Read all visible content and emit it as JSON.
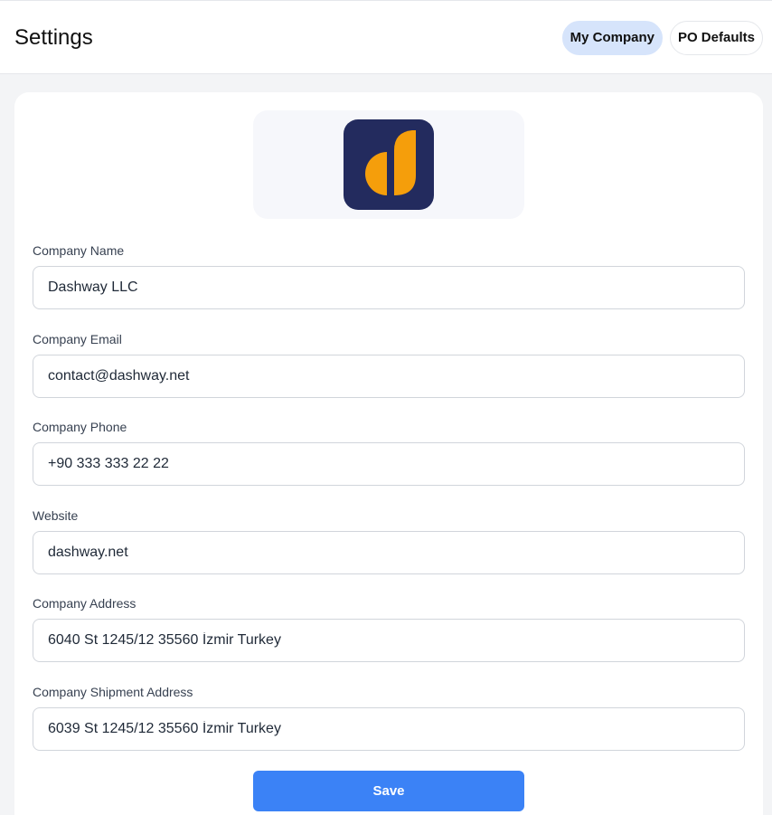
{
  "header": {
    "title": "Settings",
    "tabs": [
      {
        "label": "My Company",
        "active": true
      },
      {
        "label": "PO Defaults",
        "active": false
      }
    ]
  },
  "logo": {
    "icon": "dashway-logo-icon",
    "bg_color": "#232b5e",
    "accent_color": "#f59e0b"
  },
  "form": {
    "company_name": {
      "label": "Company Name",
      "value": "Dashway LLC"
    },
    "company_email": {
      "label": "Company Email",
      "value": "contact@dashway.net"
    },
    "company_phone": {
      "label": "Company Phone",
      "value": "+90 333 333 22 22"
    },
    "website": {
      "label": "Website",
      "value": "dashway.net"
    },
    "company_address": {
      "label": "Company Address",
      "value": "6040 St 1245/12 35560 İzmir Turkey"
    },
    "shipment_address": {
      "label": "Company Shipment Address",
      "value": "6039 St 1245/12 35560 İzmir Turkey"
    }
  },
  "save_label": "Save",
  "colors": {
    "accent": "#3b82f6",
    "tab_active": "#d6e4fb"
  }
}
